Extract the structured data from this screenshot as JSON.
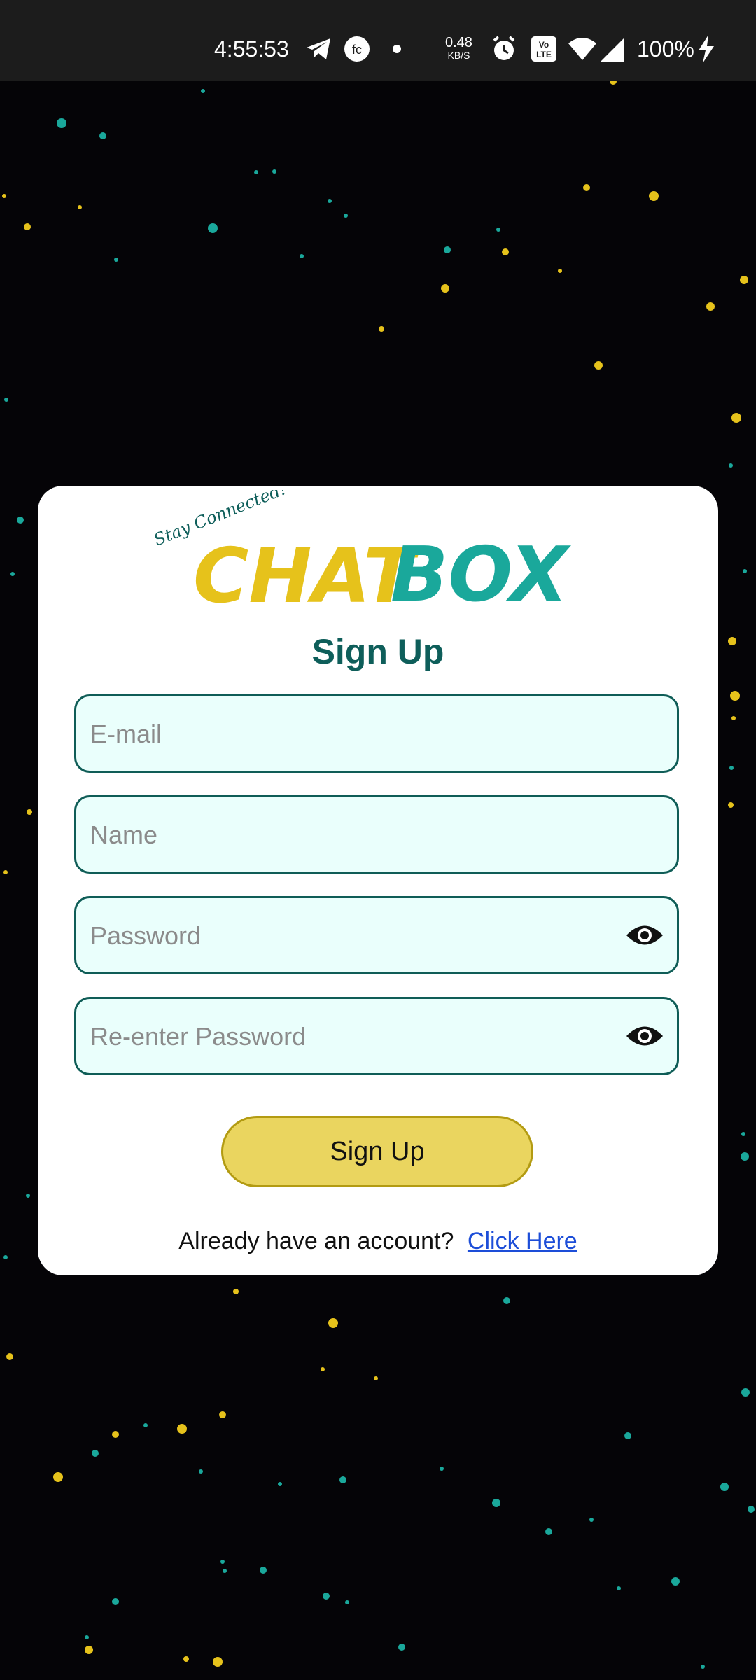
{
  "status_bar": {
    "time": "4:55:53",
    "net_speed": "0.48",
    "net_unit": "KB/S",
    "battery": "100%"
  },
  "logo": {
    "tagline": "Stay Connected!",
    "word_part1": "CHAT",
    "word_part2": "BOX",
    "color_yellow": "#e6c21b",
    "color_teal": "#1aa89b"
  },
  "form": {
    "title": "Sign Up",
    "email_placeholder": "E-mail",
    "email_value": "",
    "name_placeholder": "Name",
    "name_value": "",
    "password_placeholder": "Password",
    "password_value": "",
    "repassword_placeholder": "Re-enter Password",
    "repassword_value": "",
    "submit_label": "Sign Up",
    "footer_text": "Already have an account?",
    "footer_link": "Click Here"
  },
  "icons": [
    "telegram-icon",
    "fc-app-icon",
    "dot-icon",
    "alarm-icon",
    "volte-icon",
    "wifi-icon",
    "signal-icon",
    "charging-icon",
    "eye-icon"
  ],
  "colors": {
    "background": "#050407",
    "card": "#ffffff",
    "field_bg": "#eafffc",
    "field_border": "#0f5d57",
    "button": "#ead55f",
    "title": "#0e5e5a",
    "link": "#1d4ed8"
  }
}
